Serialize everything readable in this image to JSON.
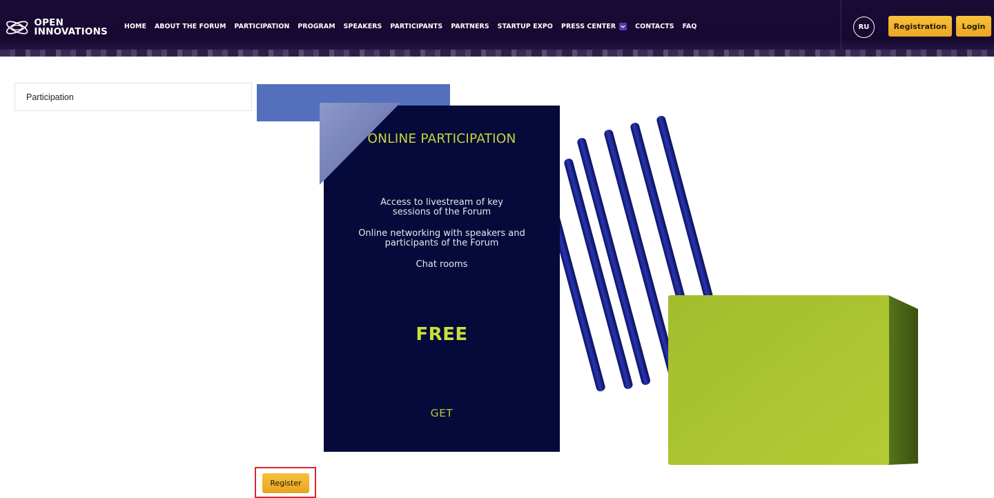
{
  "brand": {
    "line1": "OPEN",
    "line2": "INNOVATIONS"
  },
  "nav": {
    "items": [
      {
        "label": "HOME"
      },
      {
        "label": "ABOUT THE FORUM"
      },
      {
        "label": "PARTICIPATION"
      },
      {
        "label": "PROGRAM"
      },
      {
        "label": "SPEAKERS"
      },
      {
        "label": "PARTICIPANTS"
      },
      {
        "label": "PARTNERS"
      },
      {
        "label": "STARTUP EXPO"
      },
      {
        "label": "PRESS CENTER"
      },
      {
        "label": "CONTACTS"
      },
      {
        "label": "FAQ"
      }
    ]
  },
  "header": {
    "lang": "RU",
    "registration_label": "Registration",
    "login_label": "Login"
  },
  "sidebar": {
    "items": [
      {
        "label": "Participation"
      }
    ]
  },
  "card": {
    "title": "ONLINE PARTICIPATION",
    "features": [
      "Access to livestream of key",
      "sessions of the Forum",
      "Online networking with speakers and",
      "participants of the Forum",
      "Chat rooms"
    ],
    "price": "FREE",
    "cta": "GET"
  },
  "register_label": "Register",
  "colors": {
    "header_bg": "#1a0a35",
    "accent_yellow": "#f4b731",
    "card_bg": "#050a3a",
    "card_text_green": "#c8d43a",
    "stripe_blue": "#1c2480",
    "cube_green": "#a8c230",
    "sidebar_border": "#e3e3e3",
    "highlight_red": "#e0232e"
  }
}
